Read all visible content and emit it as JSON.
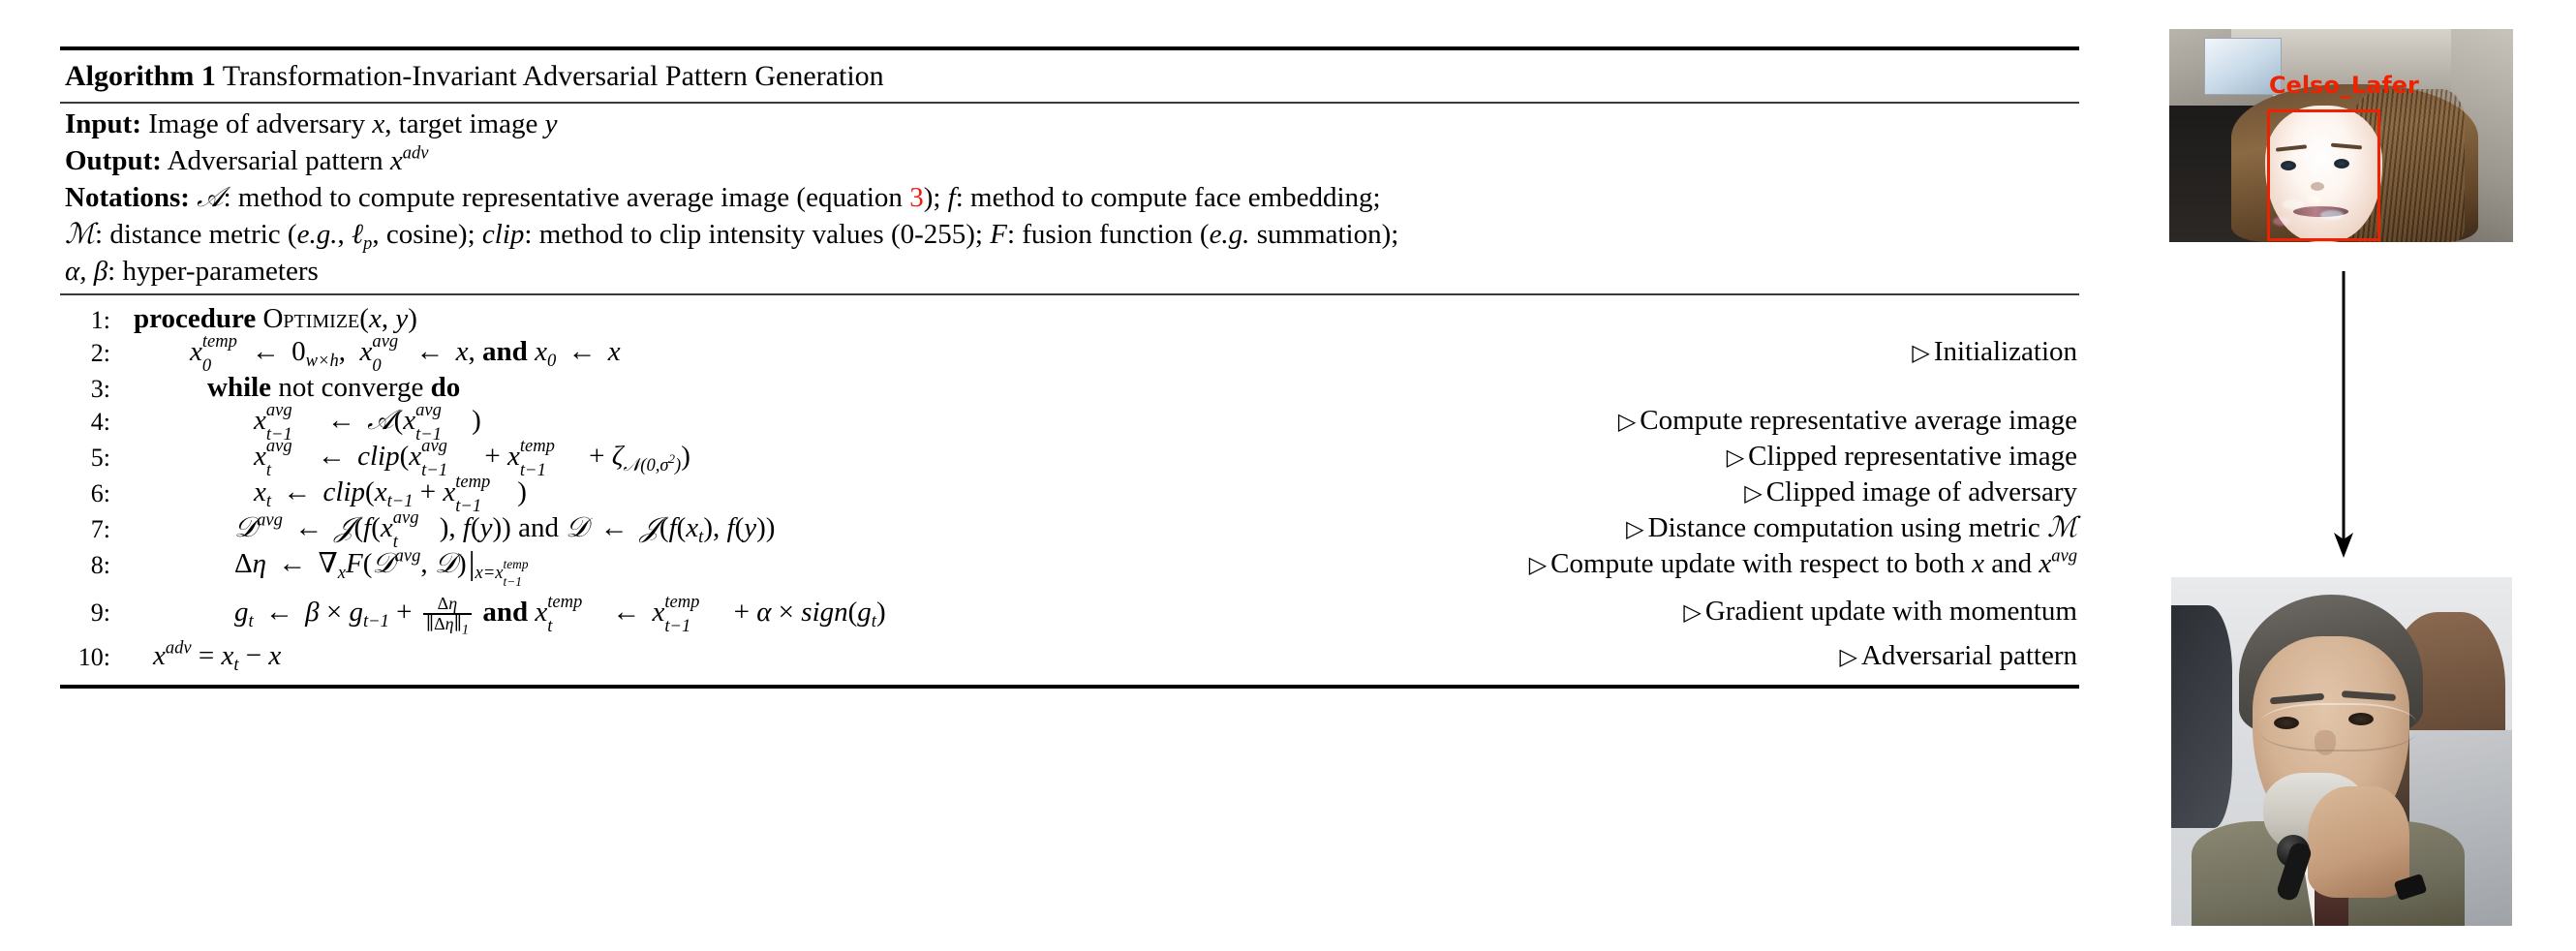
{
  "algorithm": {
    "title_label": "Algorithm 1",
    "title_text": "Transformation-Invariant Adversarial Pattern Generation",
    "preamble": {
      "input_label": "Input:",
      "input_text_a": "Image of adversary",
      "input_var_x": "x",
      "input_text_b": ", target image",
      "input_var_y": "y",
      "output_label": "Output:",
      "output_text": "Adversarial pattern",
      "output_var": "x",
      "output_var_sup": "adv",
      "notations_label": "Notations:",
      "notations_line1_a": ": method to compute representative average image (equation",
      "notations_line1_eqnum": "3",
      "notations_line1_b": ");",
      "notations_line1_c": ": method to compute face embedding;",
      "notations_line2_a": ": distance metric (",
      "notations_line2_eg": "e.g.",
      "notations_line2_b": ",",
      "notations_line2_ell": "ℓ",
      "notations_line2_ellsub": "p",
      "notations_line2_c": ", cosine);",
      "notations_line2_clip": "clip",
      "notations_line2_d": ": method to clip intensity values (0-255);",
      "notations_line2_F": "F",
      "notations_line2_e": ": fusion function (",
      "notations_line2_eg2": "e.g.",
      "notations_line2_f": "summation);",
      "notations_line3_a": "α, β",
      "notations_line3_b": ": hyper-parameters",
      "sym_A": "𝒜",
      "sym_M": "ℳ",
      "sym_f": "f"
    },
    "lines": [
      {
        "num": "1:",
        "comment": ""
      },
      {
        "num": "2:",
        "comment": "Initialization"
      },
      {
        "num": "3:",
        "comment": ""
      },
      {
        "num": "4:",
        "comment": "Compute representative average image"
      },
      {
        "num": "5:",
        "comment": "Clipped representative image"
      },
      {
        "num": "6:",
        "comment": "Clipped image of adversary"
      },
      {
        "num": "7:",
        "comment": "Distance computation using metric"
      },
      {
        "num": "8:",
        "comment": "Compute update with respect to both"
      },
      {
        "num": "9:",
        "comment": "Gradient update with momentum"
      },
      {
        "num": "10:",
        "comment": "Adversarial pattern"
      }
    ],
    "keywords": {
      "procedure": "procedure",
      "optimize": "Optimize",
      "while": "while",
      "not_converge": "not converge",
      "do": "do",
      "and": "and",
      "clip": "clip",
      "sign": "sign"
    },
    "comment_marker": "▷",
    "comment7_suffix_M": "ℳ",
    "comment8_x": "x",
    "comment8_and": "and",
    "comment8_xavg": "x",
    "comment8_xavg_sup": "avg"
  },
  "figure": {
    "top_photo": {
      "name": "adversarial-face-detection",
      "label": "Celso_Lafer",
      "label_color": "#ee2200",
      "bbox_color": "#ee2200"
    },
    "arrow": {
      "name": "down-arrow",
      "direction": "down"
    },
    "bottom_photo": {
      "name": "target-identity-portrait"
    }
  }
}
